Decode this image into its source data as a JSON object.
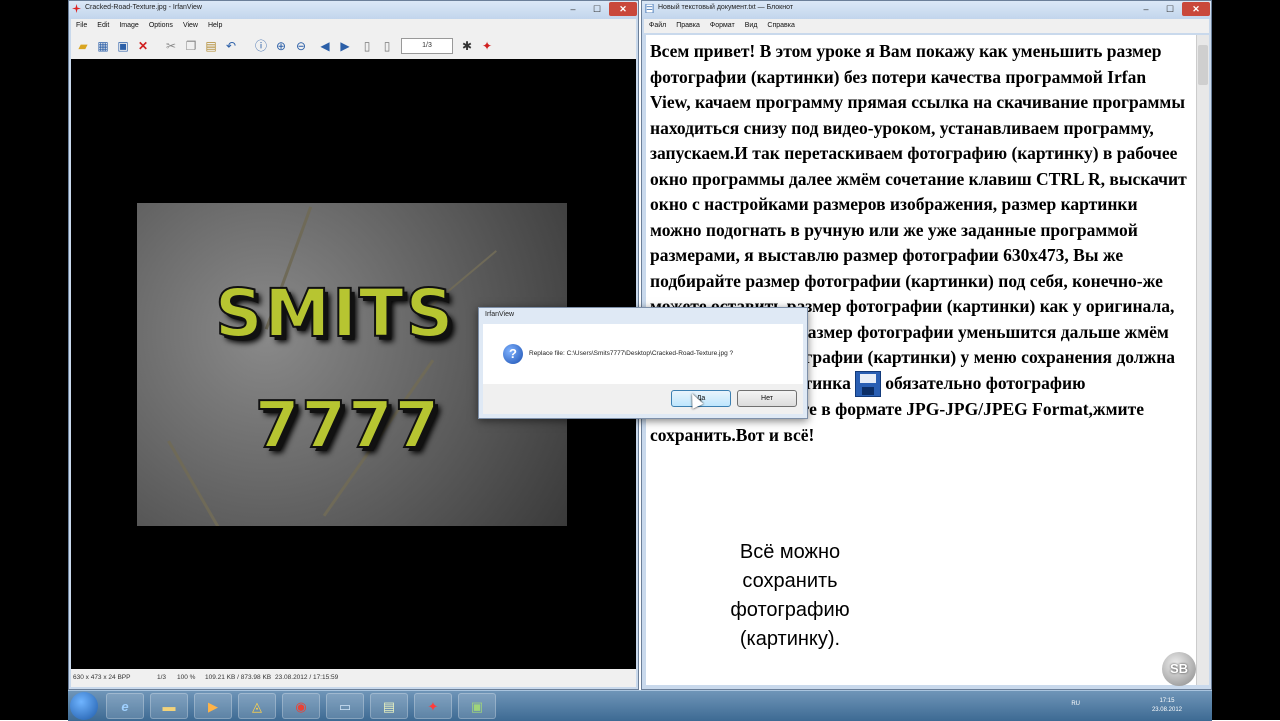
{
  "irfan": {
    "title": "Cracked-Road-Texture.jpg - IrfanView",
    "menu": [
      "File",
      "Edit",
      "Image",
      "Options",
      "View",
      "Help"
    ],
    "page_indicator": "1/3",
    "image_text_line1": "SMITS",
    "image_text_line2": "7777",
    "status": {
      "dims": "630 x 473 x 24 BPP",
      "page": "1/3",
      "zoom": "100 %",
      "size": "109.21 KB / 873.98 KB",
      "date": "23.08.2012 / 17:15:59"
    }
  },
  "dialog": {
    "title": "IrfanView",
    "message": "Replace file: C:\\Users\\Smits7777\\Desktop\\Cracked-Road-Texture.jpg ?",
    "yes_label": "Да",
    "no_label": "Нет"
  },
  "notepad": {
    "title": "Новый текстовый документ.txt — Блокнот",
    "menu": [
      "Файл",
      "Правка",
      "Формат",
      "Вид",
      "Справка"
    ],
    "text_before_icon": "Всем привет! В этом уроке я Вам покажу как уменьшить размер фотографии (картинки) без потери качества программой Irfan View, качаем программу прямая ссылка на скачивание программы находиться снизу под видео-уроком, устанавливаем программу, запускаем.И так перетаскиваем фотографию (картинку) в рабочее окно программы далее жмём сочетание клавиш CTRL R, выскачит окно с настройками размеров изображения, размер картинки можно подогнать в ручную или же уже заданные программой размерами, я выставлю размер фотографии 630x473, Вы же подбирайте размер фотографии (картинки) под себя, конечно-же можете оставить размер фотографии (картинки) как у оригинала, жмите кнопку ОК размер фотографии уменьшится дальше жмём на сохранение фотографии (картинки) у меню сохранения должна быть вот такая картинка ",
    "text_after_icon": "обязательно фотографию (картинку)сохраните в формате JPG-JPG/JPEG Format,жмите сохранить.Вот и всё!"
  },
  "caption": "Всё можно сохранить фотографию (картинку).",
  "watermark": "SB",
  "taskbar": {
    "lang": "RU",
    "time": "17:15",
    "date": "23.08.2012"
  },
  "icons": {
    "close": "close-icon",
    "minimize": "minimize-icon",
    "maximize": "maximize-icon"
  }
}
